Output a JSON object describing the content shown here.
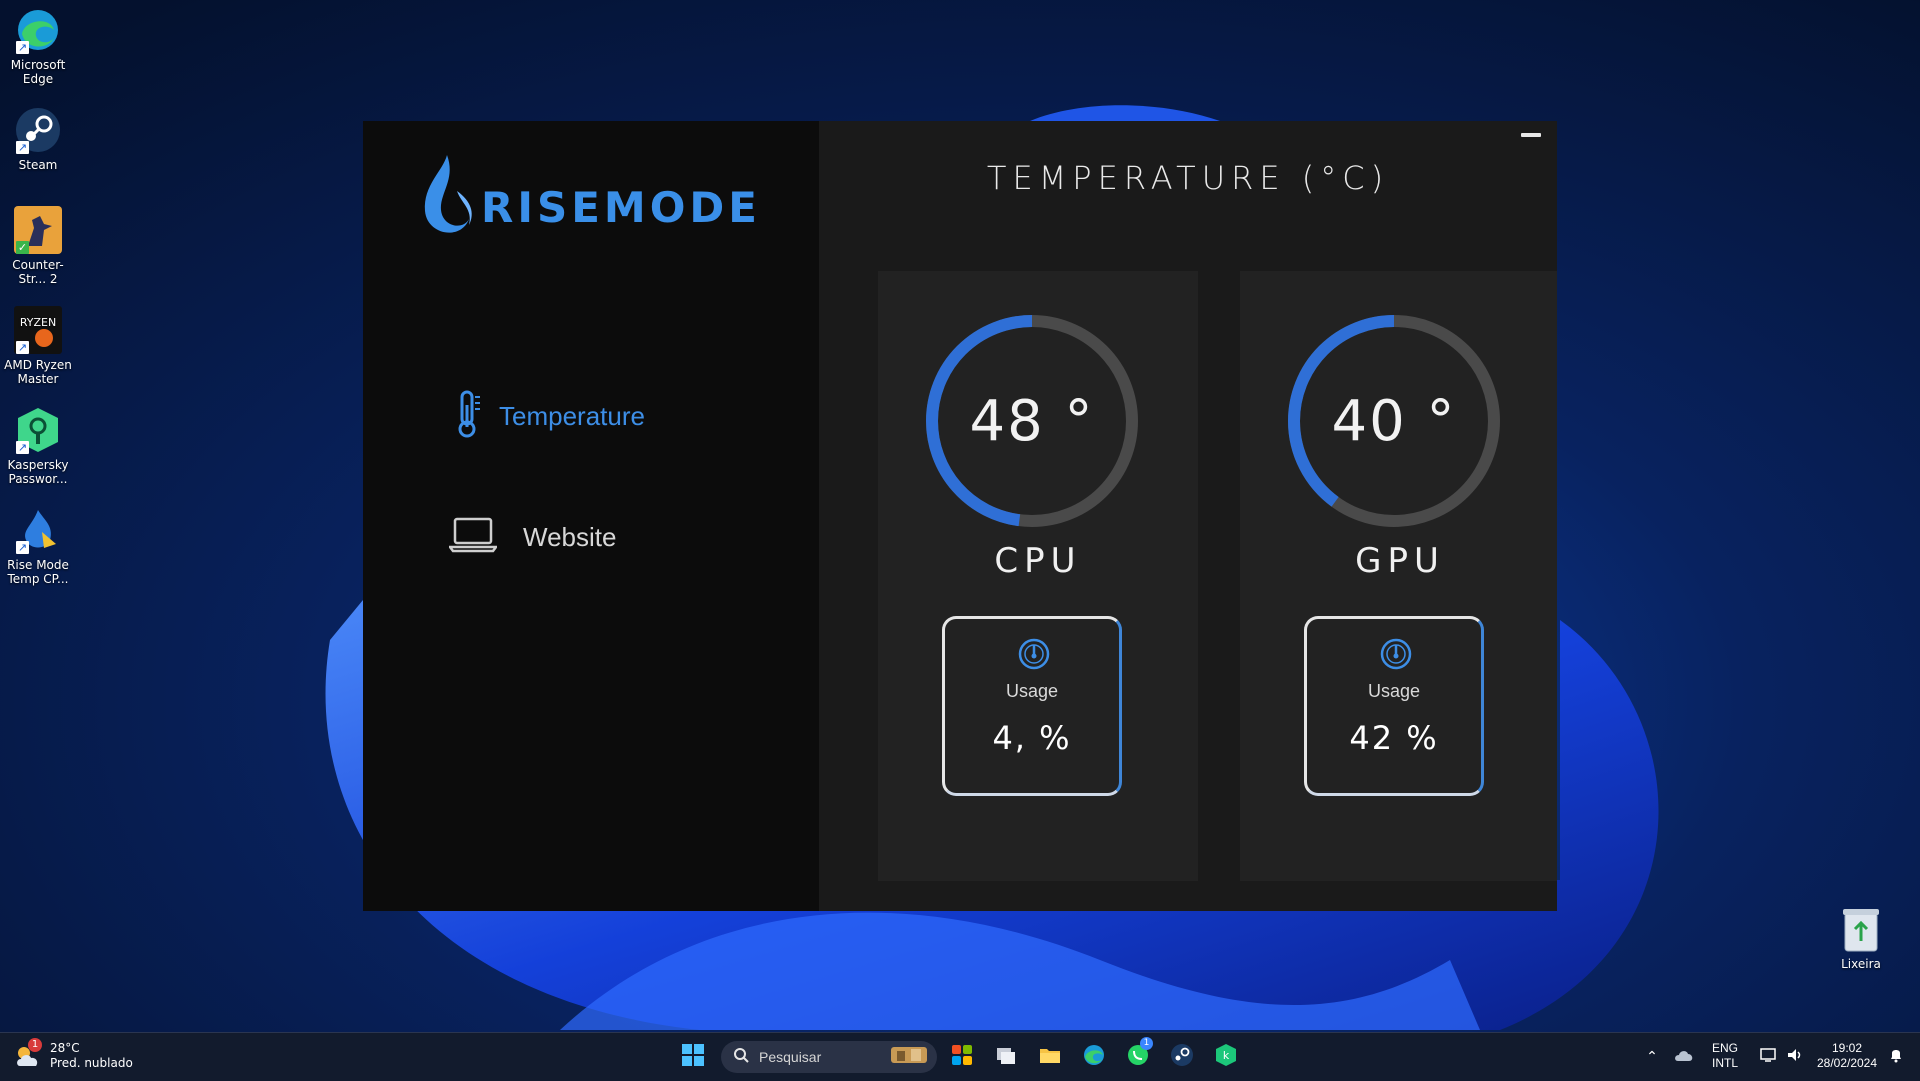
{
  "desktop": {
    "icons": [
      {
        "label": "Microsoft Edge",
        "icon": "edge-icon"
      },
      {
        "label": "Steam",
        "icon": "steam-icon"
      },
      {
        "label": "Counter-Str... 2",
        "icon": "counter-strike-icon"
      },
      {
        "label": "AMD Ryzen Master",
        "icon": "ryzen-master-icon"
      },
      {
        "label": "Kaspersky Passwor...",
        "icon": "kaspersky-password-icon"
      },
      {
        "label": "Rise Mode Temp CP...",
        "icon": "risemode-icon"
      }
    ],
    "recycle_bin": {
      "label": "Lixeira",
      "icon": "recycle-bin-icon"
    }
  },
  "app": {
    "logo_text": "RISEMODE",
    "title": "TEMPERATURE (°C)",
    "nav": [
      {
        "label": "Temperature",
        "icon": "thermometer-icon",
        "active": true
      },
      {
        "label": "Website",
        "icon": "laptop-icon",
        "active": false
      }
    ],
    "cpu": {
      "label": "CPU",
      "temperature": "48 °",
      "temp_value": 48,
      "usage_label": "Usage",
      "usage_value": "4, %"
    },
    "gpu": {
      "label": "GPU",
      "temperature": "40 °",
      "temp_value": 40,
      "usage_label": "Usage",
      "usage_value": "42 %"
    },
    "colors": {
      "accent": "#3d8ee6",
      "panel": "#222222",
      "sidebar": "#0c0c0c"
    }
  },
  "taskbar": {
    "weather": {
      "temp": "28°C",
      "desc": "Pred. nublado",
      "badge": "1"
    },
    "search_placeholder": "Pesquisar",
    "apps": [
      "windows-start-icon",
      "search-icon",
      "copilot-icon",
      "task-view-icon",
      "file-explorer-icon",
      "edge-icon",
      "whatsapp-icon",
      "steam-icon",
      "kaspersky-icon"
    ],
    "whatsapp_badge": "1",
    "language": {
      "lang": "ENG",
      "layout": "INTL"
    },
    "clock": {
      "time": "19:02",
      "date": "28/02/2024"
    }
  }
}
